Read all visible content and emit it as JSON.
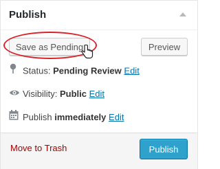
{
  "header": {
    "title": "Publish"
  },
  "buttons": {
    "save_pending": "Save as Pending",
    "preview": "Preview",
    "publish": "Publish"
  },
  "status": {
    "label": "Status: ",
    "value": "Pending Review",
    "edit": "Edit"
  },
  "visibility": {
    "label": "Visibility: ",
    "value": "Public",
    "edit": "Edit"
  },
  "schedule": {
    "label": "Publish ",
    "value": "immediately",
    "edit": "Edit"
  },
  "footer": {
    "trash_link": "Move to Trash"
  },
  "colors": {
    "accent": "#2ea2cc",
    "link": "#0073aa",
    "trash": "#aa0000",
    "highlight": "#d8232a"
  },
  "icons": [
    "collapse-arrow-icon",
    "pin-icon",
    "eye-icon",
    "calendar-icon",
    "hand-cursor-icon"
  ]
}
